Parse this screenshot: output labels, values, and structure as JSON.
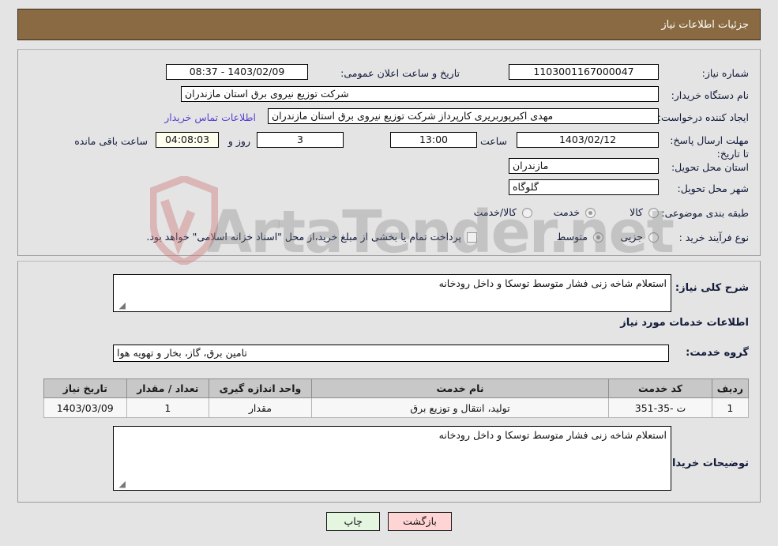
{
  "header": {
    "title": "جزئیات اطلاعات نیاز"
  },
  "top_form": {
    "need_number_label": "شماره نیاز:",
    "need_number_value": "1103001167000047",
    "public_announce_label": "تاریخ و ساعت اعلان عمومی:",
    "public_announce_value": "1403/02/09 - 08:37",
    "buyer_org_label": "نام دستگاه خریدار:",
    "buyer_org_value": "شرکت توزیع نیروی برق استان مازندران",
    "creator_label": "ایجاد کننده درخواست:",
    "creator_value": "مهدی اکبرپوربریری کارپرداز شرکت توزیع نیروی برق استان مازندران",
    "contact_link": "اطلاعات تماس خریدار",
    "deadline_label": "مهلت ارسال پاسخ: تا تاریخ:",
    "deadline_date": "1403/02/12",
    "hour_label": "ساعت",
    "hour_value": "13:00",
    "days_value": "3",
    "days_unit_label": "روز و",
    "countdown_value": "04:08:03",
    "remaining_label": "ساعت باقی مانده",
    "province_label": "استان محل تحویل:",
    "province_value": "مازندران",
    "city_label": "شهر محل تحویل:",
    "city_value": "گلوگاه",
    "category_label": "طبقه بندی موضوعی:",
    "category_options": [
      "کالا",
      "خدمت",
      "کالا/خدمت"
    ],
    "category_selected": "خدمت",
    "process_label": "نوع فرآیند خرید :",
    "process_options": [
      "جزیی",
      "متوسط"
    ],
    "process_selected": "متوسط",
    "treasury_checkbox_label": "پرداخت تمام یا بخشی از مبلغ خرید،از محل \"اسناد خزانه اسلامی\" خواهد بود.",
    "treasury_checked": false
  },
  "mid": {
    "general_desc_label": "شرح کلی نیاز:",
    "general_desc_value": "استعلام شاخه زنی فشار متوسط توسکا و داخل رودخانه",
    "services_section_title": "اطلاعات خدمات مورد نیاز",
    "service_group_label": "گروه خدمت:",
    "service_group_value": "تامین برق، گاز، بخار و تهویه هوا",
    "buyer_notes_label": "توضیحات خریدار:",
    "buyer_notes_value": "استعلام شاخه زنی فشار متوسط توسکا و داخل رودخانه"
  },
  "table": {
    "headers": [
      "ردیف",
      "کد خدمت",
      "نام خدمت",
      "واحد اندازه گیری",
      "تعداد / مقدار",
      "تاریخ نیاز"
    ],
    "rows": [
      [
        "1",
        "ت -35-351",
        "تولید، انتقال و توزیع برق",
        "مقدار",
        "1",
        "1403/03/09"
      ]
    ]
  },
  "buttons": {
    "back": "بازگشت",
    "print": "چاپ"
  },
  "watermark": {
    "text": "ArtaTender.net"
  },
  "colors": {
    "header_bg": "#8a6a42",
    "page_bg": "#e4e4e4",
    "link": "#5a3fd0",
    "back_btn": "#ffd4d4",
    "print_btn": "#e4f5e0",
    "countdown_bg": "#fffff0"
  }
}
